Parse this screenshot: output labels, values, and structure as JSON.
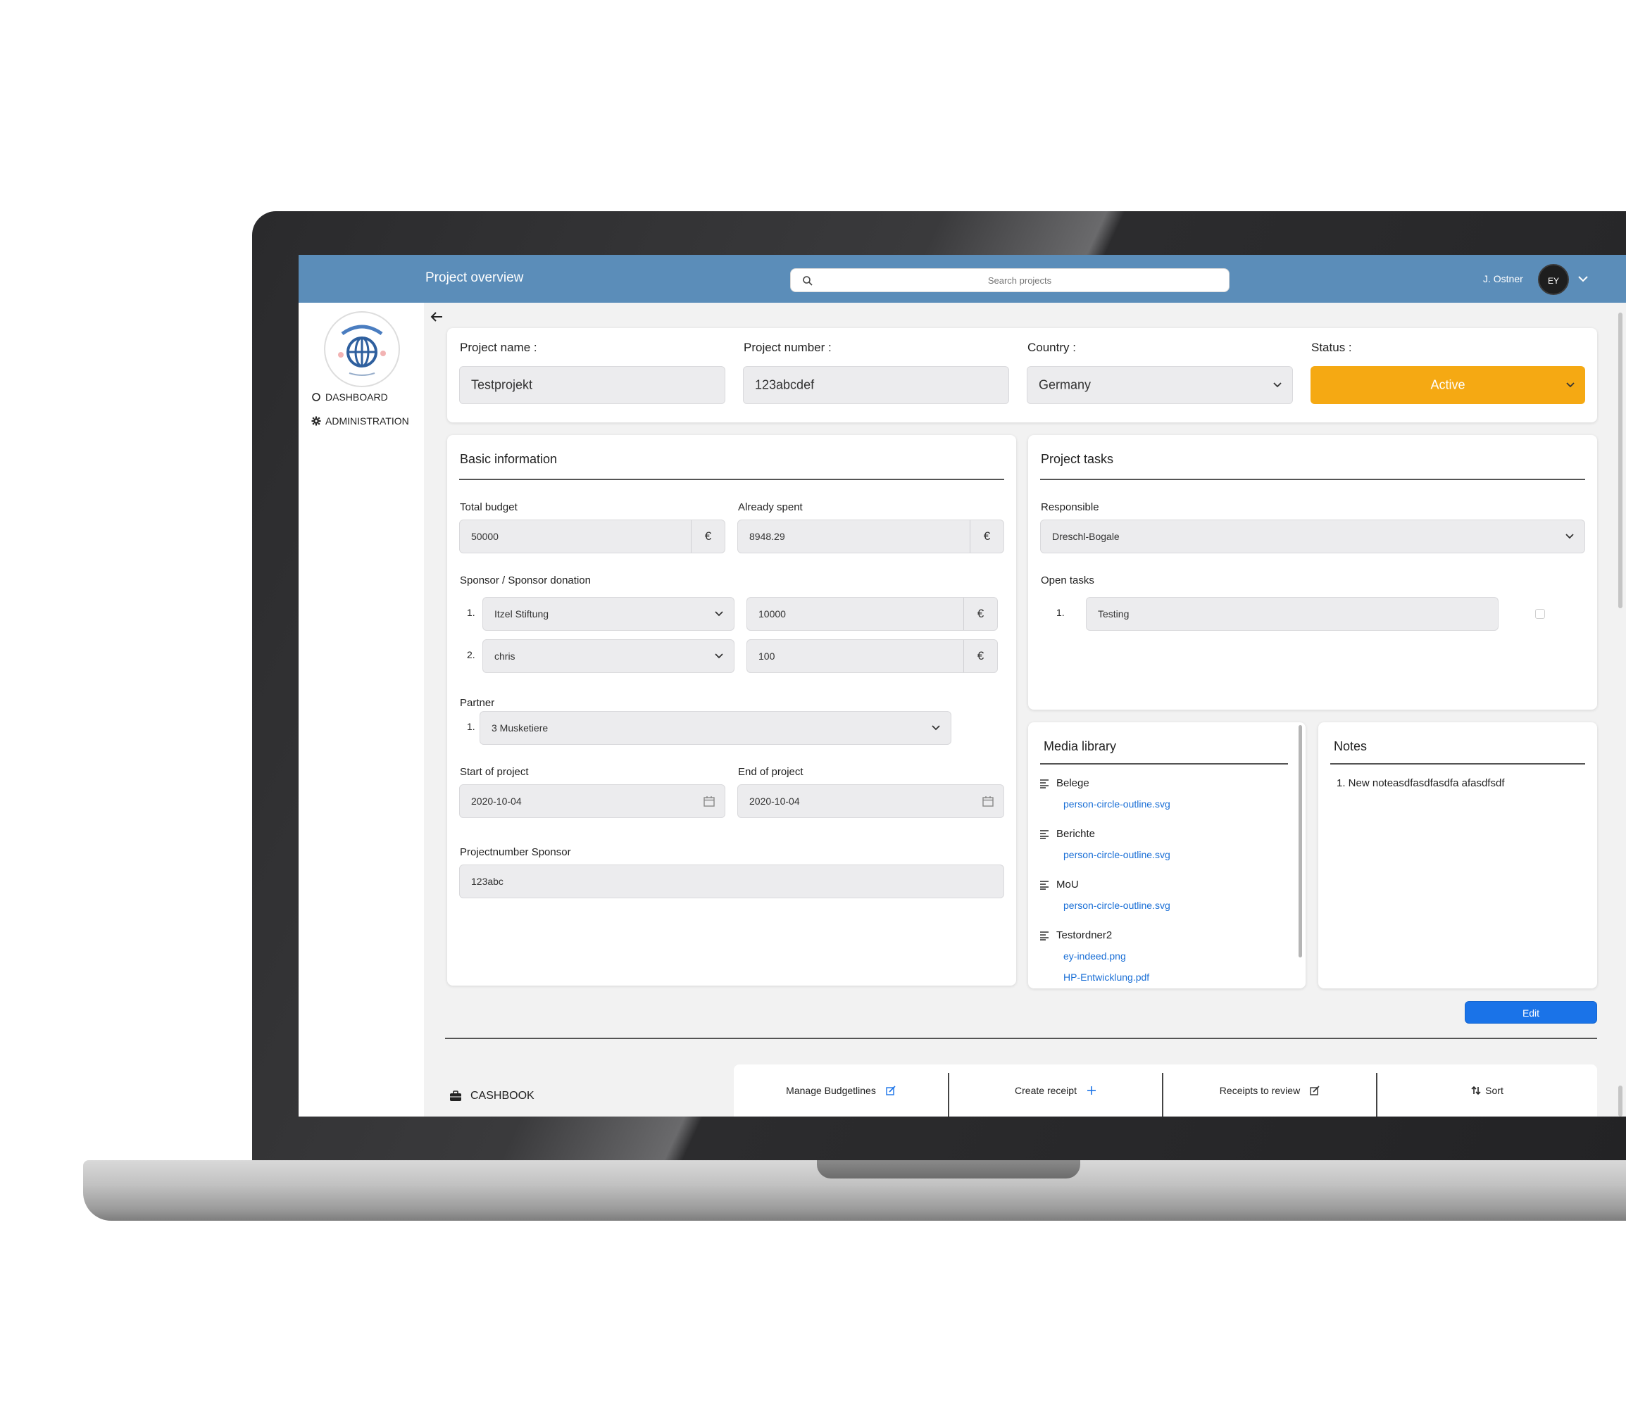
{
  "header": {
    "title": "Project overview",
    "search_placeholder": "Search projects",
    "user_name": "J. Ostner",
    "avatar_initials": "EY"
  },
  "sidebar": {
    "items": [
      {
        "label": "DASHBOARD",
        "icon": "circle-icon"
      },
      {
        "label": "ADMINISTRATION",
        "icon": "gear-icon"
      }
    ]
  },
  "project": {
    "name_label": "Project name :",
    "name_value": "Testprojekt",
    "number_label": "Project number :",
    "number_value": "123abcdef",
    "country_label": "Country :",
    "country_value": "Germany",
    "status_label": "Status :",
    "status_value": "Active",
    "status_color": "#f5a913"
  },
  "basic": {
    "title": "Basic information",
    "total_budget_label": "Total budget",
    "total_budget_value": "50000",
    "already_spent_label": "Already spent",
    "already_spent_value": "8948.29",
    "currency": "€",
    "sponsor_label": "Sponsor / Sponsor donation",
    "sponsors": [
      {
        "num": "1.",
        "name": "Itzel Stiftung",
        "amount": "10000"
      },
      {
        "num": "2.",
        "name": "chris",
        "amount": "100"
      }
    ],
    "partner_label": "Partner",
    "partners": [
      {
        "num": "1.",
        "name": "3 Musketiere"
      }
    ],
    "start_label": "Start of project",
    "start_value": "2020-10-04",
    "end_label": "End of project",
    "end_value": "2020-10-04",
    "sponsor_number_label": "Projectnumber Sponsor",
    "sponsor_number_value": "123abc"
  },
  "tasks": {
    "title": "Project tasks",
    "responsible_label": "Responsible",
    "responsible_value": "Dreschl-Bogale",
    "open_label": "Open tasks",
    "items": [
      {
        "num": "1.",
        "text": "Testing"
      }
    ]
  },
  "media": {
    "title": "Media library",
    "folders": [
      {
        "name": "Belege",
        "files": [
          "person-circle-outline.svg"
        ]
      },
      {
        "name": "Berichte",
        "files": [
          "person-circle-outline.svg"
        ]
      },
      {
        "name": "MoU",
        "files": [
          "person-circle-outline.svg"
        ]
      },
      {
        "name": "Testordner2",
        "files": [
          "ey-indeed.png",
          "HP-Entwicklung.pdf"
        ]
      }
    ],
    "link_color": "#1a6fd6"
  },
  "notes": {
    "title": "Notes",
    "items": [
      "1. New noteasdfasdfasdfa afasdfsdf"
    ]
  },
  "edit_label": "Edit",
  "cashbook": {
    "title": "CASHBOOK",
    "tools": [
      {
        "label": "Manage Budgetlines",
        "icon": "edit-icon"
      },
      {
        "label": "Create receipt",
        "icon": "plus-icon"
      },
      {
        "label": "Receipts to review",
        "icon": "edit-icon"
      },
      {
        "label": "Sort",
        "icon": "sort-arrows-icon"
      }
    ]
  },
  "accent_color": "#5b8db9",
  "button_color": "#1a73e8"
}
